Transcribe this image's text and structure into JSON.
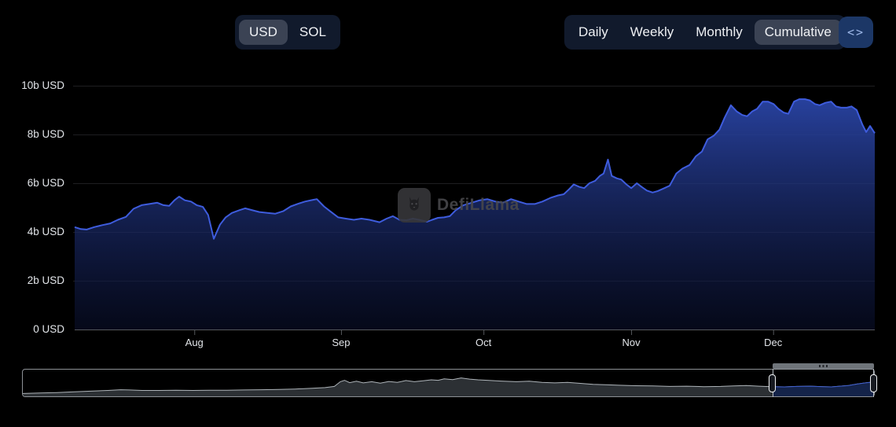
{
  "header": {
    "currency_toggle": {
      "options": [
        {
          "label": "USD",
          "selected": true
        },
        {
          "label": "SOL",
          "selected": false
        }
      ]
    },
    "interval_toggle": {
      "options": [
        {
          "label": "Daily",
          "selected": false
        },
        {
          "label": "Weekly",
          "selected": false
        },
        {
          "label": "Monthly",
          "selected": false
        },
        {
          "label": "Cumulative",
          "selected": true
        }
      ]
    },
    "embed_button": {
      "icon": "code-angle-brackets-icon",
      "label": "<>"
    }
  },
  "watermark": {
    "text": "DefiLlama",
    "icon": "defillama-llama-logo"
  },
  "colors": {
    "background": "#000000",
    "line": "#3e5cdd",
    "area_top": "#2c48ae",
    "area_bottom": "#0a102e",
    "gridline": "#1e1e20",
    "axis_line": "#55585c",
    "axis_text": "#e2e5e9",
    "nav_area_fill": "#2c3034",
    "nav_area_line": "#aeb4b9",
    "nav_selected_fill": "#142349",
    "nav_selected_line": "#3f5fd0"
  },
  "chart_data": {
    "type": "area",
    "title": "",
    "y_unit_suffix": "b USD",
    "y_ticks": [
      "10b USD",
      "8b USD",
      "6b USD",
      "4b USD",
      "2b USD",
      "0 USD"
    ],
    "y_tick_values_b": [
      10,
      8,
      6,
      4,
      2,
      0
    ],
    "ylim_b": [
      0,
      10.8
    ],
    "x_ticks": [
      "Aug",
      "Sep",
      "Oct",
      "Nov",
      "Dec"
    ],
    "x_tick_day_offsets": [
      25.2,
      56.1,
      86.1,
      117.2,
      147.1
    ],
    "x_span_days": 168.5,
    "grid": "horizontal-faint",
    "legend": "none",
    "series": [
      {
        "name": "cumulative-usd",
        "points_day_value_b": [
          [
            0,
            4.2
          ],
          [
            1.3,
            4.12
          ],
          [
            2.5,
            4.1
          ],
          [
            4.1,
            4.2
          ],
          [
            5.8,
            4.28
          ],
          [
            7.5,
            4.35
          ],
          [
            9.1,
            4.5
          ],
          [
            10.8,
            4.62
          ],
          [
            12.4,
            4.95
          ],
          [
            14.1,
            5.1
          ],
          [
            15.7,
            5.15
          ],
          [
            17.4,
            5.2
          ],
          [
            18.7,
            5.1
          ],
          [
            19.9,
            5.07
          ],
          [
            21,
            5.3
          ],
          [
            22,
            5.45
          ],
          [
            23.2,
            5.3
          ],
          [
            24.5,
            5.25
          ],
          [
            25.7,
            5.1
          ],
          [
            27,
            5.03
          ],
          [
            28.1,
            4.7
          ],
          [
            29.3,
            3.72
          ],
          [
            30.6,
            4.3
          ],
          [
            31.8,
            4.6
          ],
          [
            33.1,
            4.78
          ],
          [
            34.8,
            4.9
          ],
          [
            35.9,
            4.97
          ],
          [
            37.3,
            4.9
          ],
          [
            38.9,
            4.82
          ],
          [
            40.6,
            4.78
          ],
          [
            42.2,
            4.75
          ],
          [
            43.9,
            4.85
          ],
          [
            45.5,
            5.05
          ],
          [
            46.9,
            5.15
          ],
          [
            48.5,
            5.25
          ],
          [
            50.2,
            5.32
          ],
          [
            51,
            5.35
          ],
          [
            52.5,
            5.05
          ],
          [
            53.8,
            4.85
          ],
          [
            55.5,
            4.6
          ],
          [
            57.1,
            4.55
          ],
          [
            58.8,
            4.5
          ],
          [
            60.4,
            4.55
          ],
          [
            62.1,
            4.5
          ],
          [
            64.2,
            4.4
          ],
          [
            65.7,
            4.55
          ],
          [
            67,
            4.65
          ],
          [
            68.4,
            4.5
          ],
          [
            69.9,
            4.48
          ],
          [
            71.2,
            4.55
          ],
          [
            72.5,
            4.5
          ],
          [
            74.2,
            4.42
          ],
          [
            75.3,
            4.5
          ],
          [
            76.5,
            4.58
          ],
          [
            77.8,
            4.6
          ],
          [
            79,
            4.65
          ],
          [
            80.3,
            4.9
          ],
          [
            81.9,
            5.1
          ],
          [
            83.6,
            5.2
          ],
          [
            85.3,
            5.3
          ],
          [
            86.9,
            5.35
          ],
          [
            88.6,
            5.25
          ],
          [
            90.2,
            5.2
          ],
          [
            91.9,
            5.35
          ],
          [
            93.5,
            5.25
          ],
          [
            95.2,
            5.15
          ],
          [
            96.9,
            5.15
          ],
          [
            98.5,
            5.25
          ],
          [
            100.2,
            5.4
          ],
          [
            101.8,
            5.5
          ],
          [
            103,
            5.55
          ],
          [
            104.1,
            5.75
          ],
          [
            105.1,
            5.95
          ],
          [
            106.3,
            5.85
          ],
          [
            107.3,
            5.8
          ],
          [
            108.4,
            6.0
          ],
          [
            109.6,
            6.1
          ],
          [
            110.6,
            6.3
          ],
          [
            111.4,
            6.4
          ],
          [
            112.3,
            6.97
          ],
          [
            113.1,
            6.3
          ],
          [
            114.2,
            6.2
          ],
          [
            115.1,
            6.15
          ],
          [
            116.2,
            5.95
          ],
          [
            117.2,
            5.8
          ],
          [
            118.4,
            6.0
          ],
          [
            119.4,
            5.85
          ],
          [
            120.5,
            5.7
          ],
          [
            121.7,
            5.62
          ],
          [
            122.8,
            5.68
          ],
          [
            124.2,
            5.8
          ],
          [
            125.3,
            5.9
          ],
          [
            126.7,
            6.4
          ],
          [
            128,
            6.6
          ],
          [
            129.5,
            6.75
          ],
          [
            130.8,
            7.1
          ],
          [
            132.1,
            7.3
          ],
          [
            133.3,
            7.8
          ],
          [
            134.6,
            7.95
          ],
          [
            135.8,
            8.2
          ],
          [
            136.9,
            8.7
          ],
          [
            138.2,
            9.2
          ],
          [
            139.4,
            8.95
          ],
          [
            140.6,
            8.8
          ],
          [
            141.6,
            8.75
          ],
          [
            142.7,
            8.95
          ],
          [
            143.7,
            9.05
          ],
          [
            144.9,
            9.35
          ],
          [
            146,
            9.35
          ],
          [
            147.2,
            9.25
          ],
          [
            148.2,
            9.05
          ],
          [
            149.3,
            8.9
          ],
          [
            150.3,
            8.85
          ],
          [
            151.5,
            9.35
          ],
          [
            152.6,
            9.45
          ],
          [
            153.8,
            9.45
          ],
          [
            154.8,
            9.4
          ],
          [
            155.9,
            9.25
          ],
          [
            156.9,
            9.2
          ],
          [
            158.1,
            9.3
          ],
          [
            159.3,
            9.35
          ],
          [
            160.3,
            9.15
          ],
          [
            161.4,
            9.1
          ],
          [
            162.6,
            9.1
          ],
          [
            163.6,
            9.15
          ],
          [
            164.7,
            9.0
          ],
          [
            165.9,
            8.4
          ],
          [
            166.7,
            8.1
          ],
          [
            167.5,
            8.35
          ],
          [
            168.5,
            8.05
          ]
        ]
      }
    ],
    "navigator": {
      "selection_frac": [
        0.881,
        1.0
      ],
      "points_frac": [
        [
          0,
          0.12
        ],
        [
          0.02,
          0.14
        ],
        [
          0.04,
          0.16
        ],
        [
          0.06,
          0.19
        ],
        [
          0.08,
          0.22
        ],
        [
          0.1,
          0.25
        ],
        [
          0.115,
          0.28
        ],
        [
          0.125,
          0.27
        ],
        [
          0.14,
          0.25
        ],
        [
          0.16,
          0.25
        ],
        [
          0.18,
          0.26
        ],
        [
          0.2,
          0.25
        ],
        [
          0.22,
          0.26
        ],
        [
          0.24,
          0.26
        ],
        [
          0.26,
          0.27
        ],
        [
          0.28,
          0.28
        ],
        [
          0.3,
          0.29
        ],
        [
          0.32,
          0.31
        ],
        [
          0.34,
          0.34
        ],
        [
          0.355,
          0.37
        ],
        [
          0.366,
          0.42
        ],
        [
          0.373,
          0.62
        ],
        [
          0.378,
          0.68
        ],
        [
          0.384,
          0.58
        ],
        [
          0.392,
          0.64
        ],
        [
          0.4,
          0.57
        ],
        [
          0.41,
          0.62
        ],
        [
          0.42,
          0.56
        ],
        [
          0.43,
          0.63
        ],
        [
          0.44,
          0.59
        ],
        [
          0.45,
          0.67
        ],
        [
          0.46,
          0.62
        ],
        [
          0.47,
          0.66
        ],
        [
          0.48,
          0.7
        ],
        [
          0.488,
          0.68
        ],
        [
          0.495,
          0.74
        ],
        [
          0.505,
          0.71
        ],
        [
          0.515,
          0.78
        ],
        [
          0.525,
          0.73
        ],
        [
          0.535,
          0.7
        ],
        [
          0.55,
          0.67
        ],
        [
          0.565,
          0.64
        ],
        [
          0.58,
          0.62
        ],
        [
          0.595,
          0.64
        ],
        [
          0.61,
          0.59
        ],
        [
          0.625,
          0.57
        ],
        [
          0.64,
          0.59
        ],
        [
          0.655,
          0.55
        ],
        [
          0.67,
          0.51
        ],
        [
          0.685,
          0.49
        ],
        [
          0.7,
          0.47
        ],
        [
          0.72,
          0.45
        ],
        [
          0.74,
          0.44
        ],
        [
          0.76,
          0.42
        ],
        [
          0.78,
          0.43
        ],
        [
          0.8,
          0.41
        ],
        [
          0.82,
          0.42
        ],
        [
          0.835,
          0.44
        ],
        [
          0.85,
          0.46
        ],
        [
          0.865,
          0.43
        ],
        [
          0.88,
          0.41
        ],
        [
          0.895,
          0.4
        ],
        [
          0.91,
          0.42
        ],
        [
          0.925,
          0.43
        ],
        [
          0.94,
          0.41
        ],
        [
          0.95,
          0.4
        ],
        [
          0.96,
          0.43
        ],
        [
          0.97,
          0.46
        ],
        [
          0.98,
          0.52
        ],
        [
          0.99,
          0.57
        ],
        [
          0.995,
          0.59
        ],
        [
          1,
          0.54
        ]
      ]
    }
  }
}
